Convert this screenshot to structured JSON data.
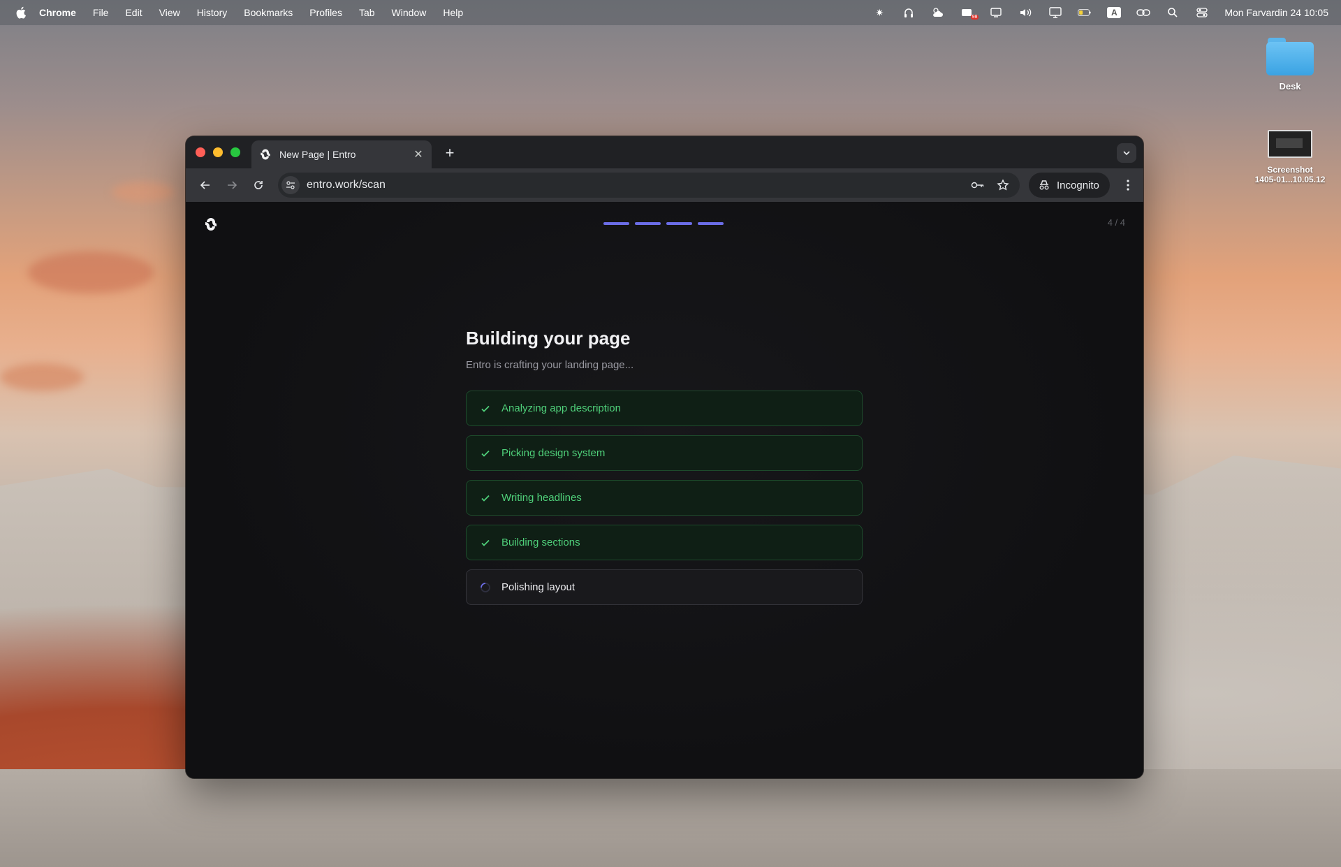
{
  "menubar": {
    "app_name": "Chrome",
    "items": [
      "File",
      "Edit",
      "View",
      "History",
      "Bookmarks",
      "Profiles",
      "Tab",
      "Window",
      "Help"
    ],
    "clock": "Mon Farvardin 24  10:05",
    "input_source": "A",
    "notification_badge": "98"
  },
  "desktop": {
    "folder_label": "Desk",
    "screenshot_label_line1": "Screenshot",
    "screenshot_label_line2": "1405-01...10.05.12"
  },
  "browser": {
    "tab_title": "New Page | Entro",
    "url": "entro.work/scan",
    "incognito_label": "Incognito"
  },
  "page": {
    "step_counter": "4 / 4",
    "progress_segments_filled": 4,
    "progress_segments_total": 4,
    "title": "Building your page",
    "subtitle": "Entro is crafting your landing page...",
    "steps": [
      {
        "label": "Analyzing app description",
        "status": "done"
      },
      {
        "label": "Picking design system",
        "status": "done"
      },
      {
        "label": "Writing headlines",
        "status": "done"
      },
      {
        "label": "Building sections",
        "status": "done"
      },
      {
        "label": "Polishing layout",
        "status": "in-progress"
      }
    ]
  },
  "colors": {
    "accent": "#6b6de6",
    "success": "#4fd07a",
    "window_bg": "#121214"
  }
}
